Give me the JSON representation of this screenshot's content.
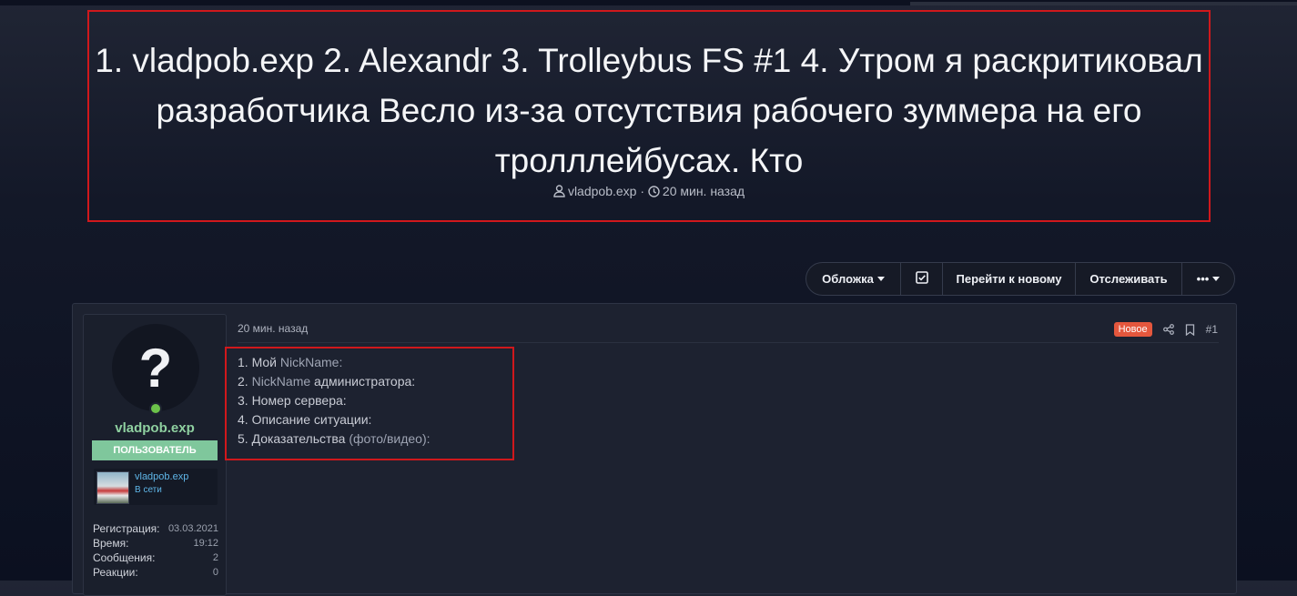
{
  "thread": {
    "title": "1. vladpob.exp 2. Alexandr 3. Trolleybus FS #1 4. Утром я раскритиковал разработчика Весло из-за отсутствия рабочего зуммера на его тролллейбусах. Кто",
    "author": "vladpob.exp",
    "time": "20 мин. назад",
    "separator": "·"
  },
  "toolbar": {
    "cover_label": "Обложка",
    "goto_new_label": "Перейти к новому",
    "watch_label": "Отслеживать",
    "more_label": "•••"
  },
  "post": {
    "date": "20 мин. назад",
    "badge": "Новое",
    "number": "#1",
    "lines": [
      {
        "prefix": "1. Мой ",
        "highlight": "NickName:",
        "suffix": ""
      },
      {
        "prefix": "2. ",
        "highlight": "NickName",
        "suffix": " администратора:"
      },
      {
        "prefix": "3. Номер сервера:",
        "highlight": "",
        "suffix": ""
      },
      {
        "prefix": "4. Описание ситуации:",
        "highlight": "",
        "suffix": ""
      },
      {
        "prefix": "5. Доказательства ",
        "highlight": "(фото/видео):",
        "suffix": ""
      }
    ]
  },
  "user": {
    "avatar_glyph": "?",
    "name": "vladpob.exp",
    "role_banner": "ПОЛЬЗОВАТЕЛЬ",
    "card_name": "vladpob.exp",
    "card_status": "В сети",
    "stats": [
      {
        "label": "Регистрация:",
        "value": "03.03.2021"
      },
      {
        "label": "Время:",
        "value": "19:12"
      },
      {
        "label": "Сообщения:",
        "value": "2"
      },
      {
        "label": "Реакции:",
        "value": "0"
      }
    ]
  },
  "colors": {
    "accent_red": "#d0181c",
    "username_green": "#8fd0a0",
    "banner_green": "#7fc79c",
    "online_green": "#6cc24a",
    "new_badge": "#e4573d",
    "link_blue": "#5fb6e8"
  },
  "icons": [
    "user-icon",
    "clock-icon",
    "checkbox-icon",
    "share-icon",
    "bookmark-icon",
    "chevron-down-icon"
  ]
}
